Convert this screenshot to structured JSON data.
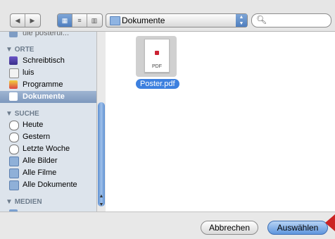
{
  "toolbar": {
    "location_label": "Dokumente",
    "search_placeholder": ""
  },
  "sidebar": {
    "top_partial_label": "ule posterui...",
    "sections": [
      {
        "title": "ORTE",
        "items": [
          "Schreibtisch",
          "luis",
          "Programme",
          "Dokumente"
        ]
      },
      {
        "title": "SUCHE",
        "items": [
          "Heute",
          "Gestern",
          "Letzte Woche",
          "Alle Bilder",
          "Alle Filme",
          "Alle Dokumente"
        ]
      },
      {
        "title": "MEDIEN",
        "items": []
      }
    ],
    "selected": "Dokumente"
  },
  "file": {
    "name": "Poster.pdf",
    "thumb_label": "PDF"
  },
  "buttons": {
    "cancel": "Abbrechen",
    "choose": "Auswählen"
  }
}
